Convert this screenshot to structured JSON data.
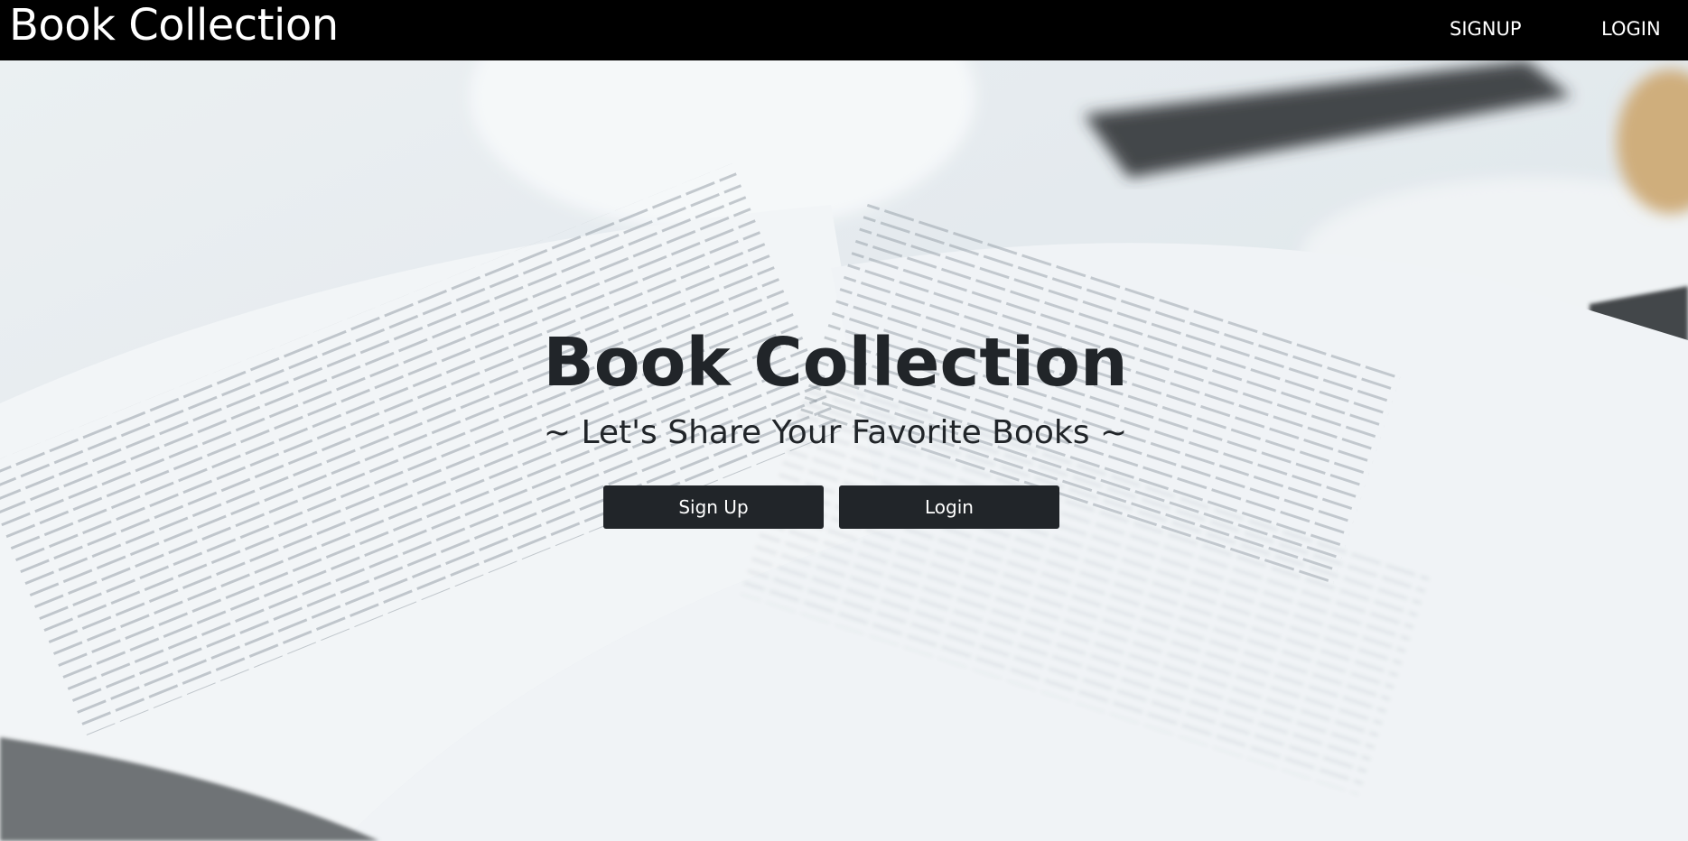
{
  "navbar": {
    "brand": "Book Collection",
    "links": [
      {
        "label": "SIGNUP"
      },
      {
        "label": "LOGIN"
      }
    ]
  },
  "hero": {
    "title": "Book Collection",
    "subtitle": "~ Let's Share Your Favorite Books ~",
    "buttons": {
      "signup": "Sign Up",
      "login": "Login"
    }
  },
  "colors": {
    "navbar_bg": "#000000",
    "button_bg": "#212529",
    "text_dark": "#212529"
  }
}
